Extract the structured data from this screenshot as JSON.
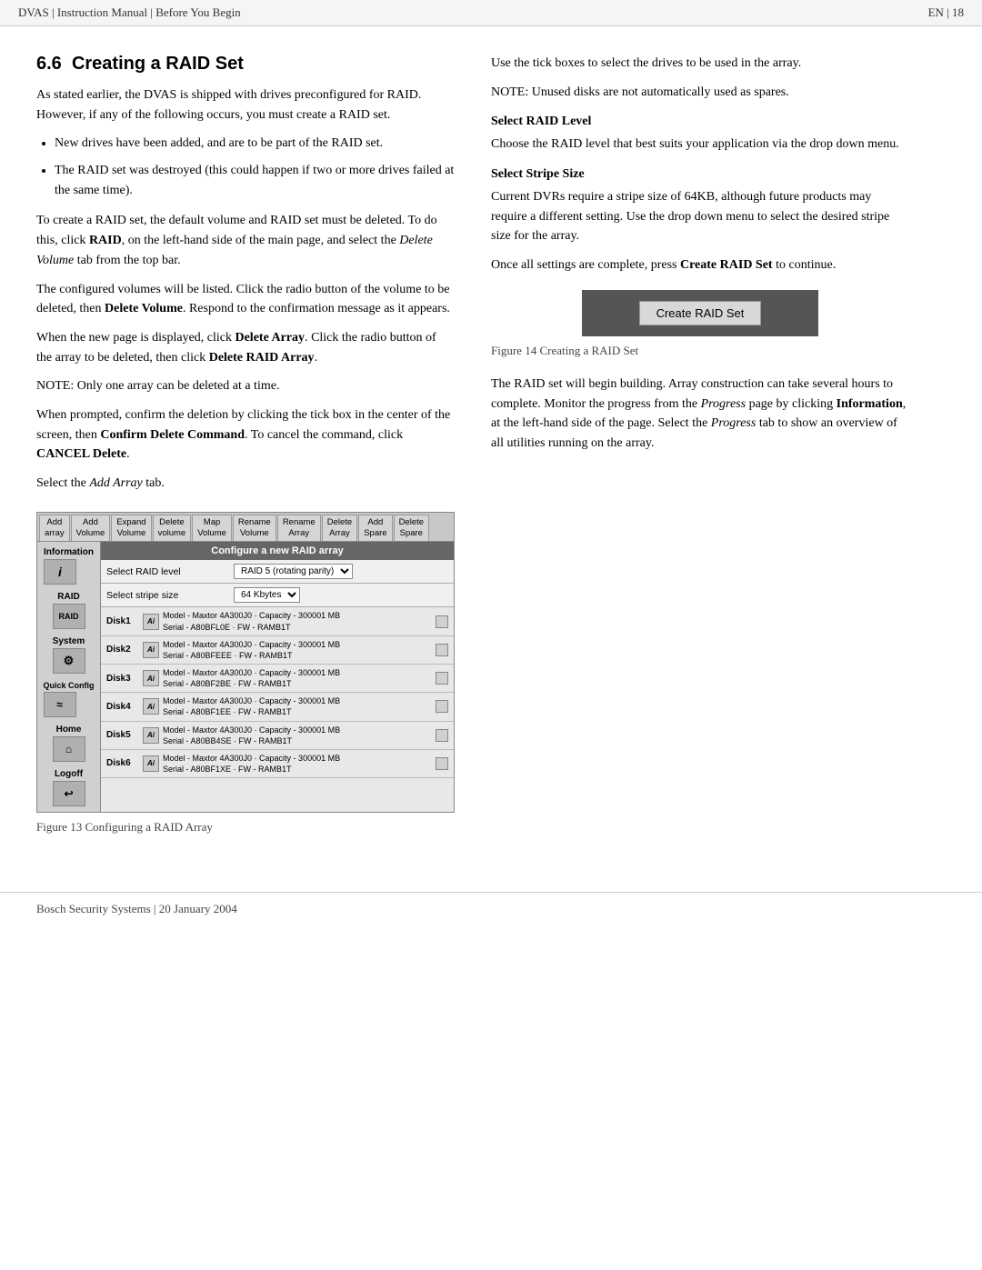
{
  "header": {
    "left": "DVAS | Instruction Manual | Before You Begin",
    "right": "EN | 18"
  },
  "section": {
    "number": "6.6",
    "title": "Creating a RAID Set"
  },
  "left_column": {
    "intro": "As stated earlier, the DVAS is shipped with drives preconfigured for RAID. However, if any of the following occurs, you must create a RAID set.",
    "bullets": [
      "New drives have been added, and are to be part of the RAID set.",
      "The RAID set was destroyed (this could happen if two or more drives failed at the same time)."
    ],
    "para1": "To create a RAID set, the default volume and RAID set must be deleted. To do this, click RAID, on the left-hand side of the main page, and select the Delete Volume tab from the top bar.",
    "para1_bold1": "RAID",
    "para1_italic1": "Delete Volume",
    "para2": "The configured volumes will be listed. Click the radio button of the volume to be deleted, then Delete Volume. Respond to the confirmation message as it appears.",
    "para2_bold1": "Delete",
    "para2_bold2": "Volume",
    "para3": "When the new page is displayed, click Delete Array. Click the radio button of the array to be deleted, then click Delete RAID Array.",
    "para3_bold1": "Delete Array",
    "para3_bold2": "Delete RAID Array",
    "para4": "NOTE: Only one array can be deleted at a time.",
    "para5_pre": "When prompted, confirm the deletion by clicking the tick box in the center of the screen, then",
    "para5_bold1": "Confirm Delete Command",
    "para5_mid": ". To cancel the command, click",
    "para5_bold2": "CANCEL Delete",
    "para5_end": ".",
    "para6": "Select the Add Array tab.",
    "para6_italic": "Add Array"
  },
  "right_column": {
    "intro": "Use the tick boxes to select the drives to be used in the array.",
    "note": "NOTE: Unused disks are not automatically used as spares.",
    "section_raid_level": {
      "title": "Select RAID Level",
      "body": "Choose the RAID level that best suits your application via the drop down menu."
    },
    "section_stripe_size": {
      "title": "Select Stripe Size",
      "body": "Current DVRs require a stripe size of 64KB, although future products may require a different setting. Use the drop down menu to select the desired stripe size for the array."
    },
    "para_create": "Once all settings are complete, press Create RAID Set to continue.",
    "para_create_bold": "Create RAID Set",
    "create_button": "Create RAID Set",
    "figure14_caption": "Figure 14  Creating a RAID Set",
    "para_building": "The RAID set will begin building. Array construction can take several hours to complete. Monitor the progress from the Progress page by clicking Information, at the left-hand side of the page. Select the Progress tab to show an overview of all utilities running on the array.",
    "para_building_italic1": "Progress",
    "para_building_bold1": "Information",
    "para_building_italic2": "Progress"
  },
  "diagram": {
    "tabs": [
      {
        "label": "Add\narray"
      },
      {
        "label": "Add\nVolume"
      },
      {
        "label": "Expand\nVolume"
      },
      {
        "label": "Delete\nvolume"
      },
      {
        "label": "Map\nVolume"
      },
      {
        "label": "Rename\nVolume"
      },
      {
        "label": "Rename\nArray"
      },
      {
        "label": "Delete\nArray"
      },
      {
        "label": "Add\nSpare"
      },
      {
        "label": "Delete\nSpare"
      }
    ],
    "sidebar_items": [
      {
        "label": "Information",
        "icon": "i"
      },
      {
        "label": "RAID",
        "icon": "RAID"
      },
      {
        "label": "System",
        "icon": "⚙"
      },
      {
        "label": "Quick Config",
        "icon": "~"
      },
      {
        "label": "Home",
        "icon": "🏠"
      },
      {
        "label": "Logoff",
        "icon": "↩"
      }
    ],
    "title_bar": "Configure a new RAID array",
    "config_rows": [
      {
        "label": "Select RAID level",
        "value": "RAID 5 (rotating parity) ▼"
      },
      {
        "label": "Select stripe size",
        "value": "64 Kbytes  ▼"
      }
    ],
    "disks": [
      {
        "label": "Disk1",
        "icon": "Ai",
        "line1": "Model - Maxtor 4A300J0  Capacity - 300001 MB",
        "line2": "Serial - A80BFL0E  FW - RAMB1T"
      },
      {
        "label": "Disk2",
        "icon": "Ai",
        "line1": "Model - Maxtor 4A300J0  Capacity - 300001 MB",
        "line2": "Serial - A80BFEEE  FW - RAMB1T"
      },
      {
        "label": "Disk3",
        "icon": "Ai",
        "line1": "Model - Maxtor 4A300J0  Capacity - 300001 MB",
        "line2": "Serial - A80BF2BE  FW - RAMB1T"
      },
      {
        "label": "Disk4",
        "icon": "Ai",
        "line1": "Model - Maxtor 4A300J0  Capacity - 300001 MB",
        "line2": "Serial - A80BF1EE  FW - RAMB1T"
      },
      {
        "label": "Disk5",
        "icon": "Ai",
        "line1": "Model - Maxtor 4A300J0  Capacity - 300001 MB",
        "line2": "Serial - A80BB4SE  FW - RAMB1T"
      },
      {
        "label": "Disk6",
        "icon": "Ai",
        "line1": "Model - Maxtor 4A300J0  Capacity - 300001 MB",
        "line2": "Serial - A80BF1XE  FW - RAMB1T"
      }
    ],
    "caption": "Figure 13  Configuring a RAID Array"
  },
  "footer": {
    "text": "Bosch Security Systems | 20 January 2004"
  }
}
